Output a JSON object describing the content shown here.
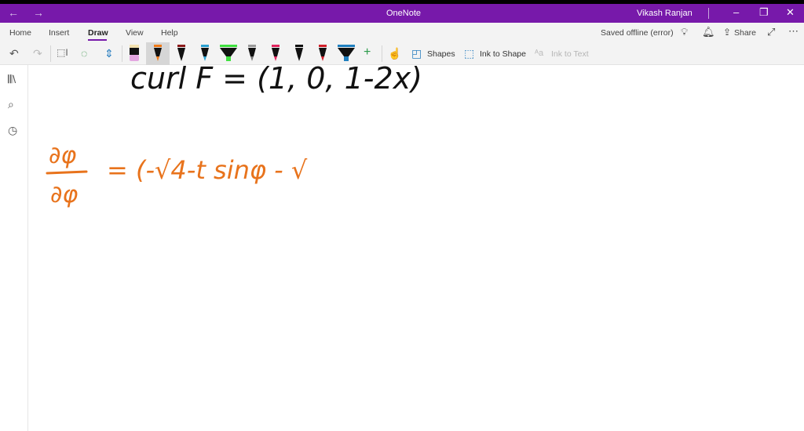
{
  "titlebar": {
    "app_title": "OneNote",
    "user": "Vikash Ranjan",
    "back_icon": "arrow-left",
    "forward_icon": "arrow-right"
  },
  "tabs": [
    {
      "label": "Home"
    },
    {
      "label": "Insert"
    },
    {
      "label": "Draw",
      "active": true
    },
    {
      "label": "View"
    },
    {
      "label": "Help"
    }
  ],
  "status": {
    "saved": "Saved offline (error)",
    "share": "Share"
  },
  "toolbar": {
    "shapes": "Shapes",
    "ink_to_shape": "Ink to Shape",
    "ink_to_text": "Ink to Text"
  },
  "pens": [
    {
      "body": "#111",
      "tip": "#e3a6e0",
      "cap": "#f3e2b0",
      "type": "eraser"
    },
    {
      "body": "#111",
      "tip": "#f07a18",
      "cap": "#f07a18",
      "selected": true
    },
    {
      "body": "#111",
      "tip": "#111",
      "cap": "#8b1a1a"
    },
    {
      "body": "#111",
      "tip": "#2aa0d0",
      "cap": "#2aa0d0"
    },
    {
      "body": "#111",
      "tip": "#3fe03f",
      "cap": "#3fe03f",
      "type": "highlighter"
    },
    {
      "body": "#111",
      "tip": "#777",
      "cap": "#999"
    },
    {
      "body": "#111",
      "tip": "#e0245e",
      "cap": "#e0245e"
    },
    {
      "body": "#111",
      "tip": "#111",
      "cap": "#111"
    },
    {
      "body": "#111",
      "tip": "#d0202a",
      "cap": "#d0202a"
    },
    {
      "body": "#111",
      "tip": "#1f7fbf",
      "cap": "#1f7fbf",
      "type": "highlighter"
    }
  ],
  "ink": {
    "line1": "curl F = (1, 0, 1-2x)",
    "line2_num": "∂φ",
    "line2_den": "∂φ",
    "line2_rest": "= (-√4-t sinφ - √",
    "black": "#111111",
    "orange": "#e8731c"
  },
  "colors": {
    "accent": "#7719aa"
  }
}
